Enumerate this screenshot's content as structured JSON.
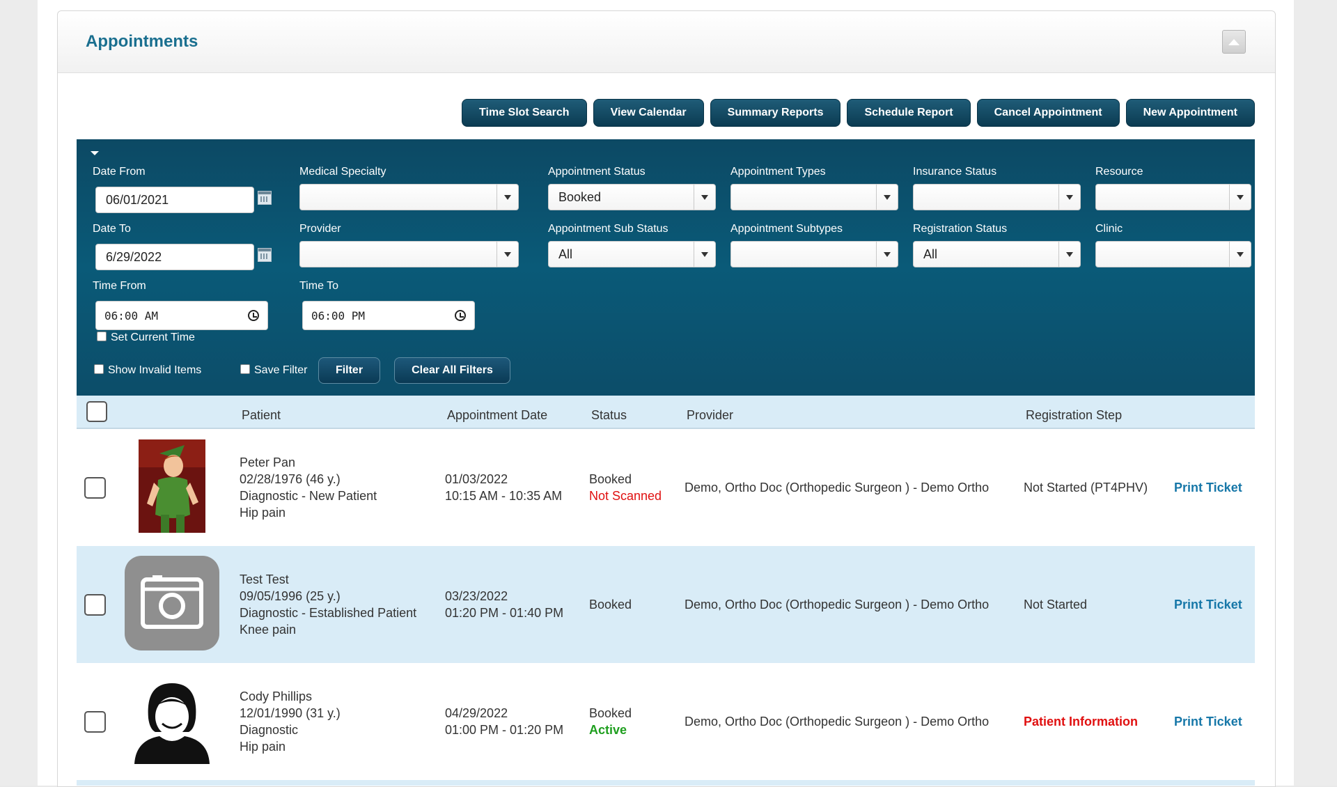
{
  "panel": {
    "title": "Appointments"
  },
  "actions": [
    {
      "name": "time-slot-search-button",
      "label": "Time Slot Search"
    },
    {
      "name": "view-calendar-button",
      "label": "View Calendar"
    },
    {
      "name": "summary-reports-button",
      "label": "Summary Reports"
    },
    {
      "name": "schedule-report-button",
      "label": "Schedule Report"
    },
    {
      "name": "cancel-appointment-button",
      "label": "Cancel Appointment"
    },
    {
      "name": "new-appointment-button",
      "label": "New Appointment"
    }
  ],
  "filters": {
    "date_from": {
      "label": "Date From",
      "value": "06/01/2021"
    },
    "date_to": {
      "label": "Date To",
      "value": "6/29/2022"
    },
    "time_from": {
      "label": "Time From",
      "value": "06:00 AM"
    },
    "time_to": {
      "label": "Time To",
      "value": "06:00 PM"
    },
    "set_current_time": "Set Current Time",
    "medical_specialty": {
      "label": "Medical Specialty",
      "value": ""
    },
    "provider": {
      "label": "Provider",
      "value": ""
    },
    "appointment_status": {
      "label": "Appointment Status",
      "value": "Booked"
    },
    "appointment_sub_status": {
      "label": "Appointment Sub Status",
      "value": "All"
    },
    "appointment_types": {
      "label": "Appointment Types",
      "value": ""
    },
    "appointment_subtypes": {
      "label": "Appointment Subtypes",
      "value": ""
    },
    "insurance_status": {
      "label": "Insurance Status",
      "value": ""
    },
    "registration_status": {
      "label": "Registration Status",
      "value": "All"
    },
    "resource": {
      "label": "Resource",
      "value": ""
    },
    "clinic": {
      "label": "Clinic",
      "value": ""
    },
    "show_invalid_items": "Show Invalid Items",
    "save_filter": "Save Filter",
    "filter_button": "Filter",
    "clear_button": "Clear All Filters"
  },
  "table": {
    "columns": [
      "Patient",
      "Appointment Date",
      "Status",
      "Provider",
      "Registration Step"
    ],
    "rows": [
      {
        "name": "Peter Pan",
        "dob": "02/28/1976 (46 y.)",
        "type": "Diagnostic - New Patient",
        "complaint": "Hip pain",
        "date": "01/03/2022",
        "time": "10:15 AM - 10:35 AM",
        "status": "Booked",
        "sub_status": "Not Scanned",
        "provider": "Demo, Ortho Doc (Orthopedic Surgeon ) - Demo Ortho",
        "registration": "Not Started (PT4PHV)",
        "action": "Print Ticket"
      },
      {
        "name": "Test Test",
        "dob": "09/05/1996 (25 y.)",
        "type": "Diagnostic - Established Patient",
        "complaint": "Knee pain",
        "date": "03/23/2022",
        "time": "01:20 PM - 01:40 PM",
        "status": "Booked",
        "sub_status": "",
        "provider": "Demo, Ortho Doc (Orthopedic Surgeon ) - Demo Ortho",
        "registration": "Not Started",
        "action": "Print Ticket"
      },
      {
        "name": "Cody Phillips",
        "dob": "12/01/1990 (31 y.)",
        "type": "Diagnostic",
        "complaint": "Hip pain",
        "date": "04/29/2022",
        "time": "01:00 PM - 01:20 PM",
        "status": "Booked",
        "sub_status": "Active",
        "provider": "Demo, Ortho Doc (Orthopedic Surgeon ) - Demo Ortho",
        "registration": "Patient Information",
        "action": "Print Ticket"
      }
    ]
  },
  "colors": {
    "title": "#1a6f8f",
    "filter_bg": "#0a5a78",
    "row_alt": "#d9ecf7",
    "link": "#1677a8",
    "alert": "#e01010",
    "active": "#1f9f1f"
  }
}
